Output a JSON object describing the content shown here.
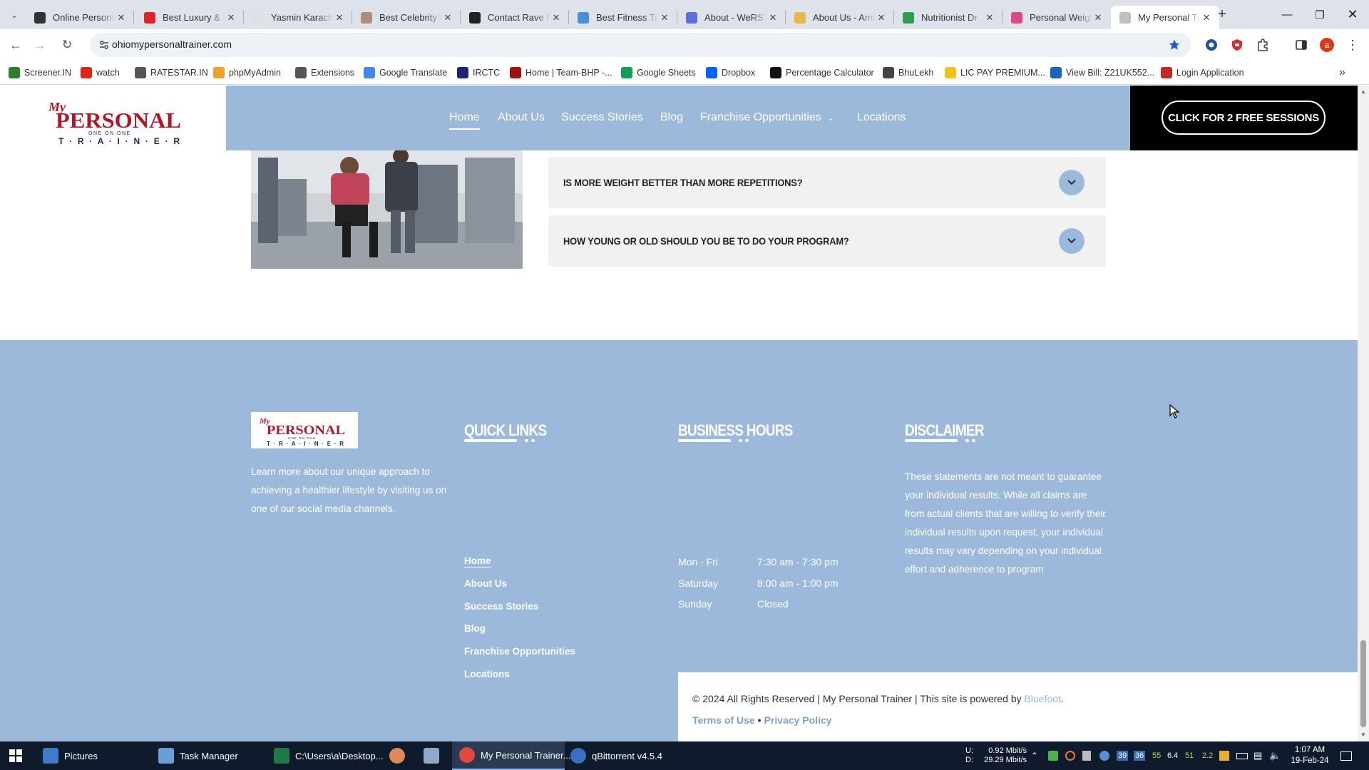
{
  "browser": {
    "tabs": [
      {
        "title": "Online Personal Trainer",
        "icon_color": "#333333"
      },
      {
        "title": "Best Luxury & Personal",
        "icon_color": "#d9252a"
      },
      {
        "title": "Yasmin Karachiwala",
        "icon_color": "#e0e0e0"
      },
      {
        "title": "Best Celebrity Fitness",
        "icon_color": "#b08d7a"
      },
      {
        "title": "Contact Rave Fitness",
        "icon_color": "#222222"
      },
      {
        "title": "Best Fitness Trainer",
        "icon_color": "#4a90d9"
      },
      {
        "title": "About - WeRSTK",
        "icon_color": "#5b6fd8"
      },
      {
        "title": "About Us - Amit",
        "icon_color": "#e8b84a"
      },
      {
        "title": "Nutritionist Dr",
        "icon_color": "#2e9e4a"
      },
      {
        "title": "Personal Weight",
        "icon_color": "#d94a8a"
      },
      {
        "title": "My Personal Trainer",
        "icon_color": "#c0c0c0"
      }
    ],
    "url": "ohiomypersonaltrainer.com",
    "profile_initial": "a",
    "bookmarks": [
      {
        "label": "Screener.IN",
        "icon_color": "#2e7d32"
      },
      {
        "label": "watch",
        "icon_color": "#e62117"
      },
      {
        "label": "RATESTAR.IN",
        "icon_color": "#555555"
      },
      {
        "label": "phpMyAdmin",
        "icon_color": "#f0a030"
      },
      {
        "label": "Extensions",
        "icon_color": "#555555"
      },
      {
        "label": "Google Translate",
        "icon_color": "#4285f4"
      },
      {
        "label": "IRCTC",
        "icon_color": "#1a237e"
      },
      {
        "label": "Home | Team-BHP -...",
        "icon_color": "#a01010"
      },
      {
        "label": "Google Sheets",
        "icon_color": "#0f9d58"
      },
      {
        "label": "Dropbox",
        "icon_color": "#0061fe"
      },
      {
        "label": "Percentage Calculator",
        "icon_color": "#111111"
      },
      {
        "label": "BhuLekh",
        "icon_color": "#444444"
      },
      {
        "label": "LIC PAY PREMIUM...",
        "icon_color": "#f0c419"
      },
      {
        "label": "View Bill: Z21UK552...",
        "icon_color": "#1565c0"
      },
      {
        "label": "Login Application",
        "icon_color": "#c62828"
      }
    ]
  },
  "site": {
    "logo": {
      "my": "My",
      "personal": "PERSONAL",
      "one_on_one": "ONE ON ONE",
      "trainer": "T · R · A · I · N · E · R"
    },
    "nav": [
      "Home",
      "About Us",
      "Success Stories",
      "Blog",
      "Franchise Opportunities",
      "Locations"
    ],
    "cta": "CLICK FOR 2 FREE SESSIONS",
    "faq": [
      "IS MORE WEIGHT BETTER THAN MORE REPETITIONS?",
      "HOW YOUNG OR OLD SHOULD YOU BE TO DO YOUR PROGRAM?"
    ],
    "footer": {
      "about_text": "Learn more about our unique approach to achieving a healthier lifestyle by visiting us on one of our social media channels.",
      "quick_links_heading": "QUICK LINKS",
      "quick_links": [
        "Home",
        "About Us",
        "Success Stories",
        "Blog",
        "Franchise Opportunities",
        "Locations"
      ],
      "hours_heading": "BUSINESS HOURS",
      "hours": [
        {
          "day": "Mon - Fri",
          "time": "7:30 am - 7:30 pm"
        },
        {
          "day": "Saturday",
          "time": "8:00 am - 1:00 pm"
        },
        {
          "day": "Sunday",
          "time": "Closed"
        }
      ],
      "disclaimer_heading": "DISCLAIMER",
      "disclaimer_text": "These statements are not meant to guarantee your individual results. While all claims are from actual clients that are willing to verify their individual results upon request, your individual results may vary depending on your individual effort and adherence to program",
      "copyright_prefix": "© 2024 All Rights Reserved | My Personal Trainer | This site is powered by ",
      "powered_by": "Bluefoot",
      "copyright_suffix": ".",
      "terms": "Terms of Use",
      "legal_sep": "•",
      "privacy": "Privacy Policy"
    }
  },
  "taskbar": {
    "tasks": [
      "Pictures",
      "Task Manager",
      "C:\\Users\\a\\Desktop...",
      "My Personal Trainer...",
      "qBittorrent v4.5.4"
    ],
    "net_up_label": "U:",
    "net_up": "0.92 Mbit/s",
    "net_down_label": "D:",
    "net_down": "29.29 Mbit/s",
    "tray_numbers": [
      "39",
      "36",
      "55",
      "6.4",
      "51",
      "2.2"
    ],
    "time": "1:07 AM",
    "date": "19-Feb-24"
  },
  "colors": {
    "brand_blue": "#9cb9dc",
    "logo_red": "#b0182a",
    "logo_navy": "#1b2a6b"
  }
}
